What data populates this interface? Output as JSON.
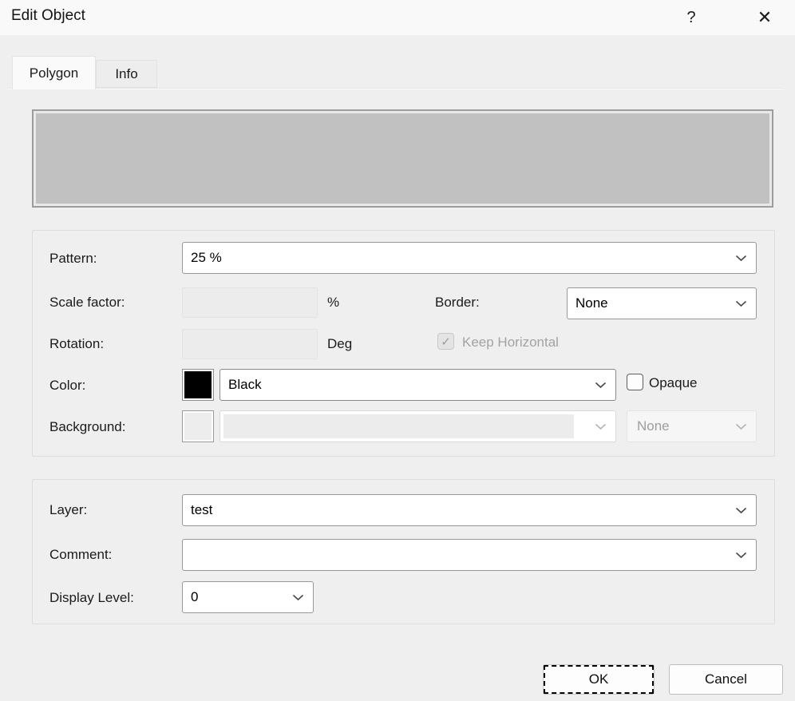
{
  "window": {
    "title": "Edit Object",
    "help_glyph": "?",
    "close_glyph": "✕"
  },
  "tabs": [
    {
      "label": "Polygon"
    },
    {
      "label": "Info"
    }
  ],
  "polygon_tab": {
    "pattern": {
      "label": "Pattern:",
      "value": "25 %"
    },
    "scale_factor": {
      "label": "Scale factor:",
      "value": "",
      "unit": "%"
    },
    "border": {
      "label": "Border:",
      "value": "None"
    },
    "rotation": {
      "label": "Rotation:",
      "value": "",
      "unit": "Deg"
    },
    "keep_horizontal": {
      "label": "Keep Horizontal",
      "checked": true,
      "check_glyph": "✓"
    },
    "color": {
      "label": "Color:",
      "value": "Black",
      "swatch_hex": "#000000"
    },
    "opaque": {
      "label": "Opaque",
      "checked": false
    },
    "background": {
      "label": "Background:",
      "value": "",
      "swatch_hex": "#ededed",
      "mode_value": "None"
    },
    "layer": {
      "label": "Layer:",
      "value": "test"
    },
    "comment": {
      "label": "Comment:",
      "value": ""
    },
    "display_level": {
      "label": "Display Level:",
      "value": "0"
    }
  },
  "buttons": {
    "ok_label": "OK",
    "cancel_label": "Cancel"
  },
  "preview": {
    "fill_hex": "#c1c1c1"
  },
  "colors": {
    "dialog_bg": "#efefef",
    "titlebar_bg": "#f9f9f9",
    "preview_border": "#9d9d9d"
  }
}
